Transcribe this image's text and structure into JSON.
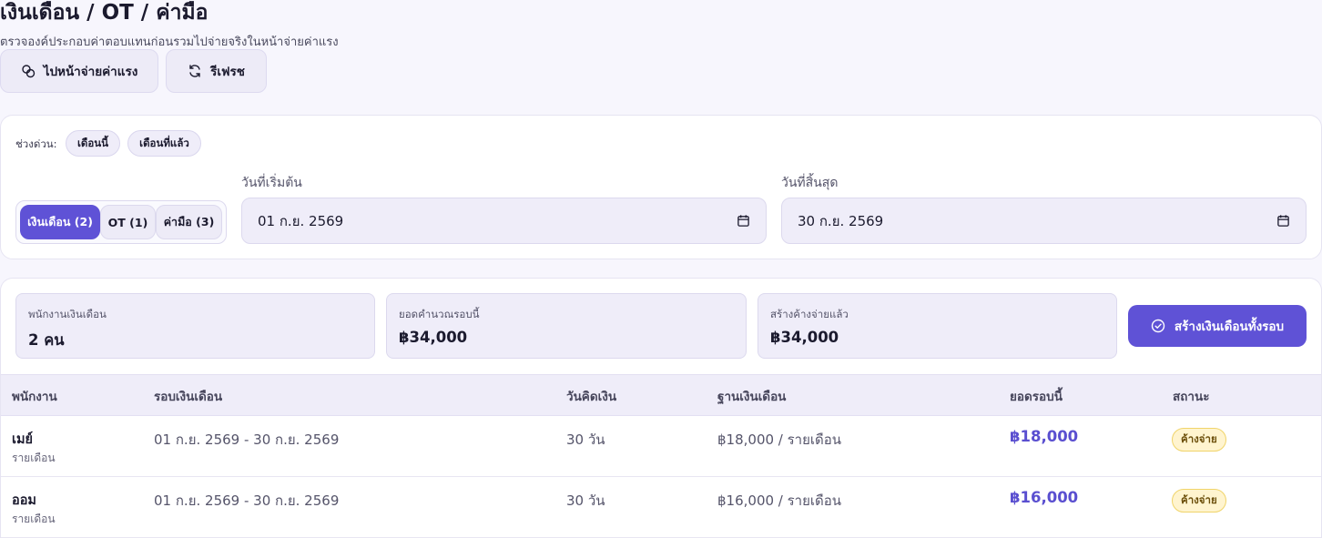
{
  "header": {
    "title": "เงินเดือน / OT / ค่ามือ",
    "subtitle": "ตรวจองค์ประกอบค่าตอบแทนก่อนรวมไปจ่ายจริงในหน้าจ่ายค่าแรง",
    "payroll_button": "ไปหน้าจ่ายค่าแรง",
    "refresh_button": "รีเฟรช"
  },
  "filter": {
    "quick_label": "ช่วงด่วน:",
    "chips": [
      "เดือนนี้",
      "เดือนที่แล้ว"
    ],
    "segments": [
      {
        "label": "เงินเดือน (2)",
        "active": true
      },
      {
        "label": "OT (1)",
        "active": false
      },
      {
        "label": "ค่ามือ (3)",
        "active": false
      }
    ],
    "start_label": "วันที่เริ่มต้น",
    "start_value": "01 ก.ย. 2569",
    "end_label": "วันที่สิ้นสุด",
    "end_value": "30 ก.ย. 2569"
  },
  "summary": {
    "stats": [
      {
        "label": "พนักงานเงินเดือน",
        "value": "2 คน"
      },
      {
        "label": "ยอดคำนวณรอบนี้",
        "value": "฿34,000"
      },
      {
        "label": "สร้างค้างจ่ายแล้ว",
        "value": "฿34,000"
      }
    ],
    "create_button": "สร้างเงินเดือนทั้งรอบ"
  },
  "table": {
    "columns": [
      "พนักงาน",
      "รอบเงินเดือน",
      "วันคิดเงิน",
      "ฐานเงินเดือน",
      "ยอดรอบนี้",
      "สถานะ"
    ],
    "rows": [
      {
        "name": "เมย์",
        "type": "รายเดือน",
        "period": "01 ก.ย. 2569 - 30 ก.ย. 2569",
        "days": "30 วัน",
        "base": "฿18,000 / รายเดือน",
        "amount": "฿18,000",
        "status": "ค้างจ่าย"
      },
      {
        "name": "ออม",
        "type": "รายเดือน",
        "period": "01 ก.ย. 2569 - 30 ก.ย. 2569",
        "days": "30 วัน",
        "base": "฿16,000 / รายเดือน",
        "amount": "฿16,000",
        "status": "ค้างจ่าย"
      }
    ]
  },
  "colors": {
    "accent": "#5f52d6",
    "badge_bg": "#fff4cf"
  }
}
